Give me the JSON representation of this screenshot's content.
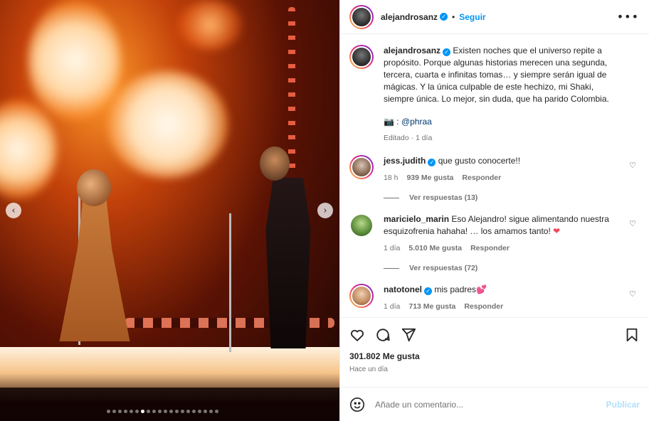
{
  "header": {
    "username": "alejandrosanz",
    "separator": "•",
    "follow_label": "Seguir",
    "more_label": "•••"
  },
  "photo": {
    "prev_label": "‹",
    "next_label": "›",
    "total_slides": 20,
    "active_slide": 7
  },
  "caption": {
    "username": "alejandrosanz",
    "text": "Existen noches que el universo repite a propósito. Porque algunas historias merecen una segunda, tercera, cuarta e infinitas tomas… y siempre serán igual de mágicas. Y la única culpable de este hechizo, mi Shaki, siempre única. Lo mejor, sin duda, que ha parido Colombia.",
    "credit_prefix": "📷 : ",
    "credit_mention": "@phraa",
    "meta": "Editado · 1 día"
  },
  "comments": [
    {
      "username": "jess.judith",
      "verified": true,
      "text": "que gusto conocerte!!",
      "time": "18 h",
      "likes": "939 Me gusta",
      "reply": "Responder",
      "view_replies": "Ver respuestas (13)"
    },
    {
      "username": "maricielo_marin",
      "verified": false,
      "text": "Eso Alejandro! sigue alimentando nuestra esquizofrenia hahaha! … los amamos tanto! ",
      "emoji": "❤",
      "time": "1 día",
      "likes": "5.010 Me gusta",
      "reply": "Responder",
      "view_replies": "Ver respuestas (72)"
    },
    {
      "username": "natotonel",
      "verified": true,
      "text": "mis padres",
      "emoji": "💕",
      "time": "1 día",
      "likes": "713 Me gusta",
      "reply": "Responder"
    }
  ],
  "footer": {
    "likes": "301.802 Me gusta",
    "ago": "Hace un día",
    "comment_placeholder": "Añade un comentario...",
    "publish_label": "Publicar"
  },
  "colors": {
    "accent": "#0095f6",
    "heart": "#ed4956"
  }
}
